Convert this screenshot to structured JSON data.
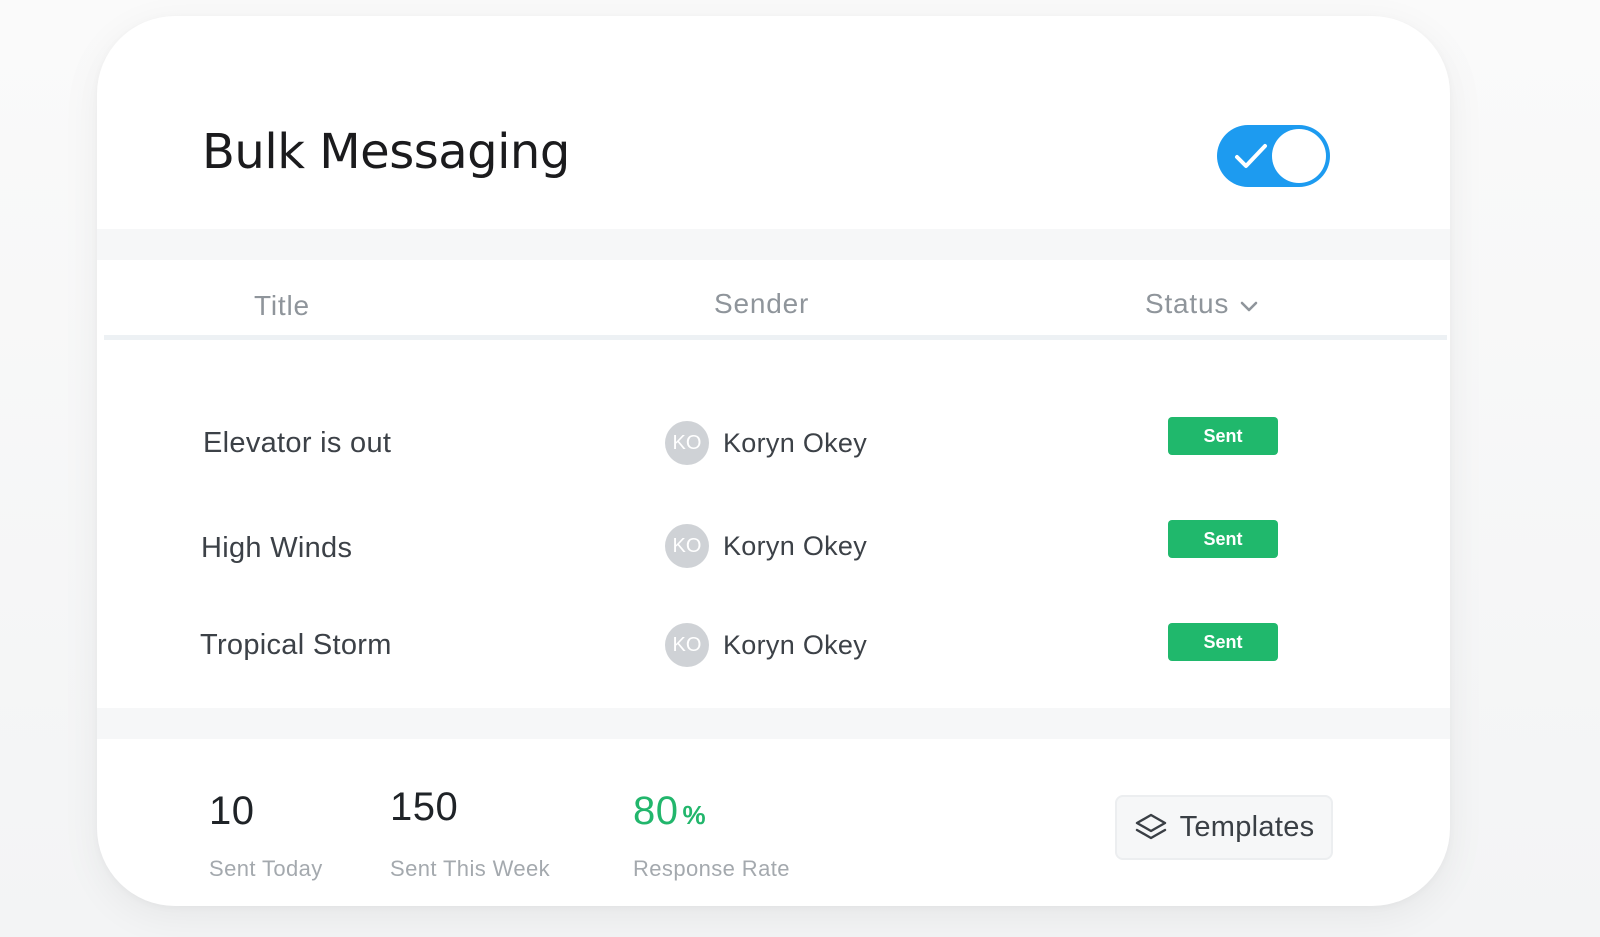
{
  "header": {
    "title": "Bulk Messaging",
    "toggle_on": true,
    "accent_color": "#1d9bf0"
  },
  "table": {
    "columns": [
      "Title",
      "Sender",
      "Status"
    ],
    "rows": [
      {
        "title": "Elevator is out",
        "sender_initials": "KO",
        "sender_name": "Koryn Okey",
        "status": "Sent"
      },
      {
        "title": "High Winds",
        "sender_initials": "KO",
        "sender_name": "Koryn Okey",
        "status": "Sent"
      },
      {
        "title": "Tropical Storm",
        "sender_initials": "KO",
        "sender_name": "Koryn Okey",
        "status": "Sent"
      }
    ],
    "status_color": "#20b86c"
  },
  "stats": [
    {
      "value": "10",
      "label": "Sent Today"
    },
    {
      "value": "150",
      "label": "Sent This Week"
    },
    {
      "value": "80",
      "unit": "%",
      "label": "Response Rate"
    }
  ],
  "footer": {
    "templates_label": "Templates"
  }
}
